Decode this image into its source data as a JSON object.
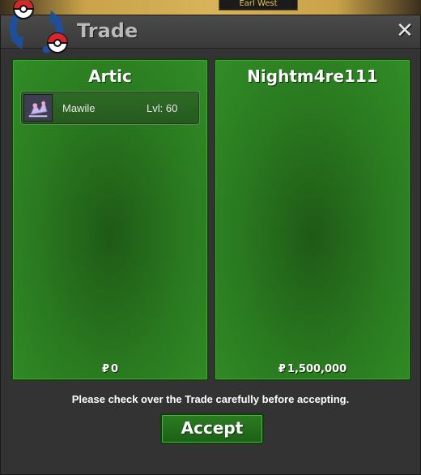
{
  "window": {
    "title": "Trade",
    "close_glyph": "✕",
    "icon": "trade-exchange-icon"
  },
  "background": {
    "fragment_text": "Earl West"
  },
  "left_panel": {
    "player_name": "Artic",
    "currency_symbol": "₽",
    "money": "0",
    "items": [
      {
        "name": "Mawile",
        "level": "Lvl: 60",
        "icon": "mawile-sprite-icon"
      }
    ]
  },
  "right_panel": {
    "player_name": "Nightm4re111",
    "currency_symbol": "₽",
    "money": "1,500,000",
    "items": []
  },
  "notice": "Please check over the Trade carefully before accepting.",
  "accept_label": "Accept",
  "colors": {
    "panel_green": "#2a7a20",
    "window_bg": "#333333",
    "title_text": "#b9b9b9"
  }
}
